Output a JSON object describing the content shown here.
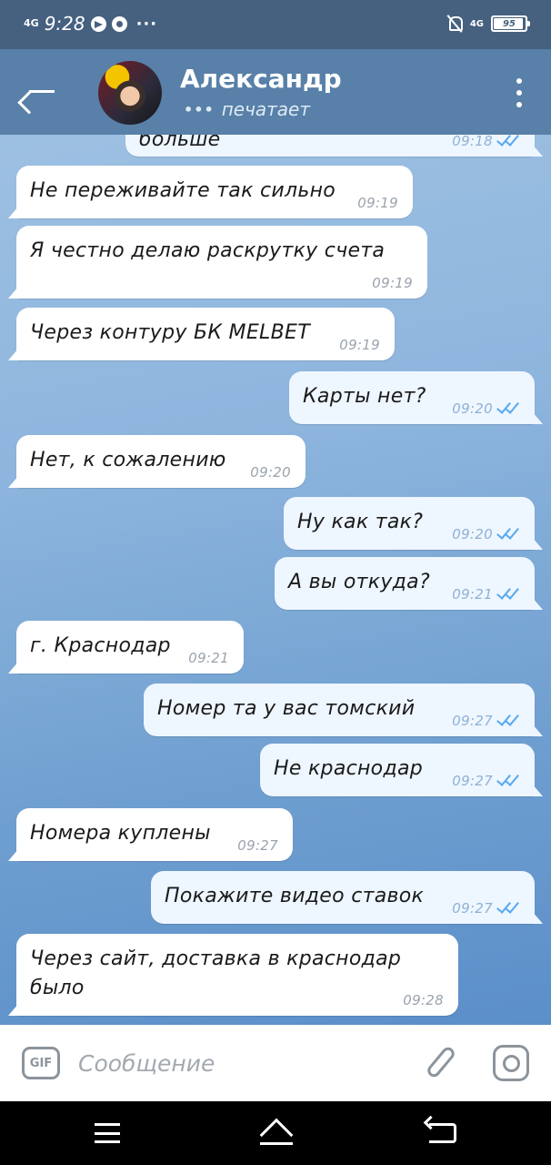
{
  "status_bar": {
    "signal": "4G",
    "time": "9:28",
    "more": "···",
    "network": "4G",
    "battery": "95",
    "battery_level": 0.95
  },
  "header": {
    "contact_name": "Александр",
    "status_dots": "•••",
    "status": "печатает"
  },
  "messages": [
    {
      "dir": "out",
      "text": "больше",
      "time": "09:18",
      "read": true
    },
    {
      "dir": "in",
      "text": "Не переживайте так сильно",
      "time": "09:19"
    },
    {
      "dir": "in",
      "text": "Я честно делаю раскрутку счета",
      "time": "09:19"
    },
    {
      "dir": "in",
      "text": "Через контуру БК MELBET",
      "time": "09:19"
    },
    {
      "dir": "out",
      "text": "Карты нет?",
      "time": "09:20",
      "read": true
    },
    {
      "dir": "in",
      "text": "Нет, к сожалению",
      "time": "09:20"
    },
    {
      "dir": "out",
      "text": "Ну как так?",
      "time": "09:20",
      "read": true
    },
    {
      "dir": "out",
      "text": "А вы откуда?",
      "time": "09:21",
      "read": true
    },
    {
      "dir": "in",
      "text": "г. Краснодар",
      "time": "09:21"
    },
    {
      "dir": "out",
      "text": "Номер та у вас томский",
      "time": "09:27",
      "read": true
    },
    {
      "dir": "out",
      "text": "Не краснодар",
      "time": "09:27",
      "read": true
    },
    {
      "dir": "in",
      "text": "Номера куплены",
      "time": "09:27"
    },
    {
      "dir": "out",
      "text": "Покажите видео ставок",
      "time": "09:27",
      "read": true
    },
    {
      "dir": "in",
      "text": "Через сайт,  доставка в краснодар было",
      "time": "09:28"
    }
  ],
  "input": {
    "gif_label": "GIF",
    "placeholder": "Сообщение"
  }
}
